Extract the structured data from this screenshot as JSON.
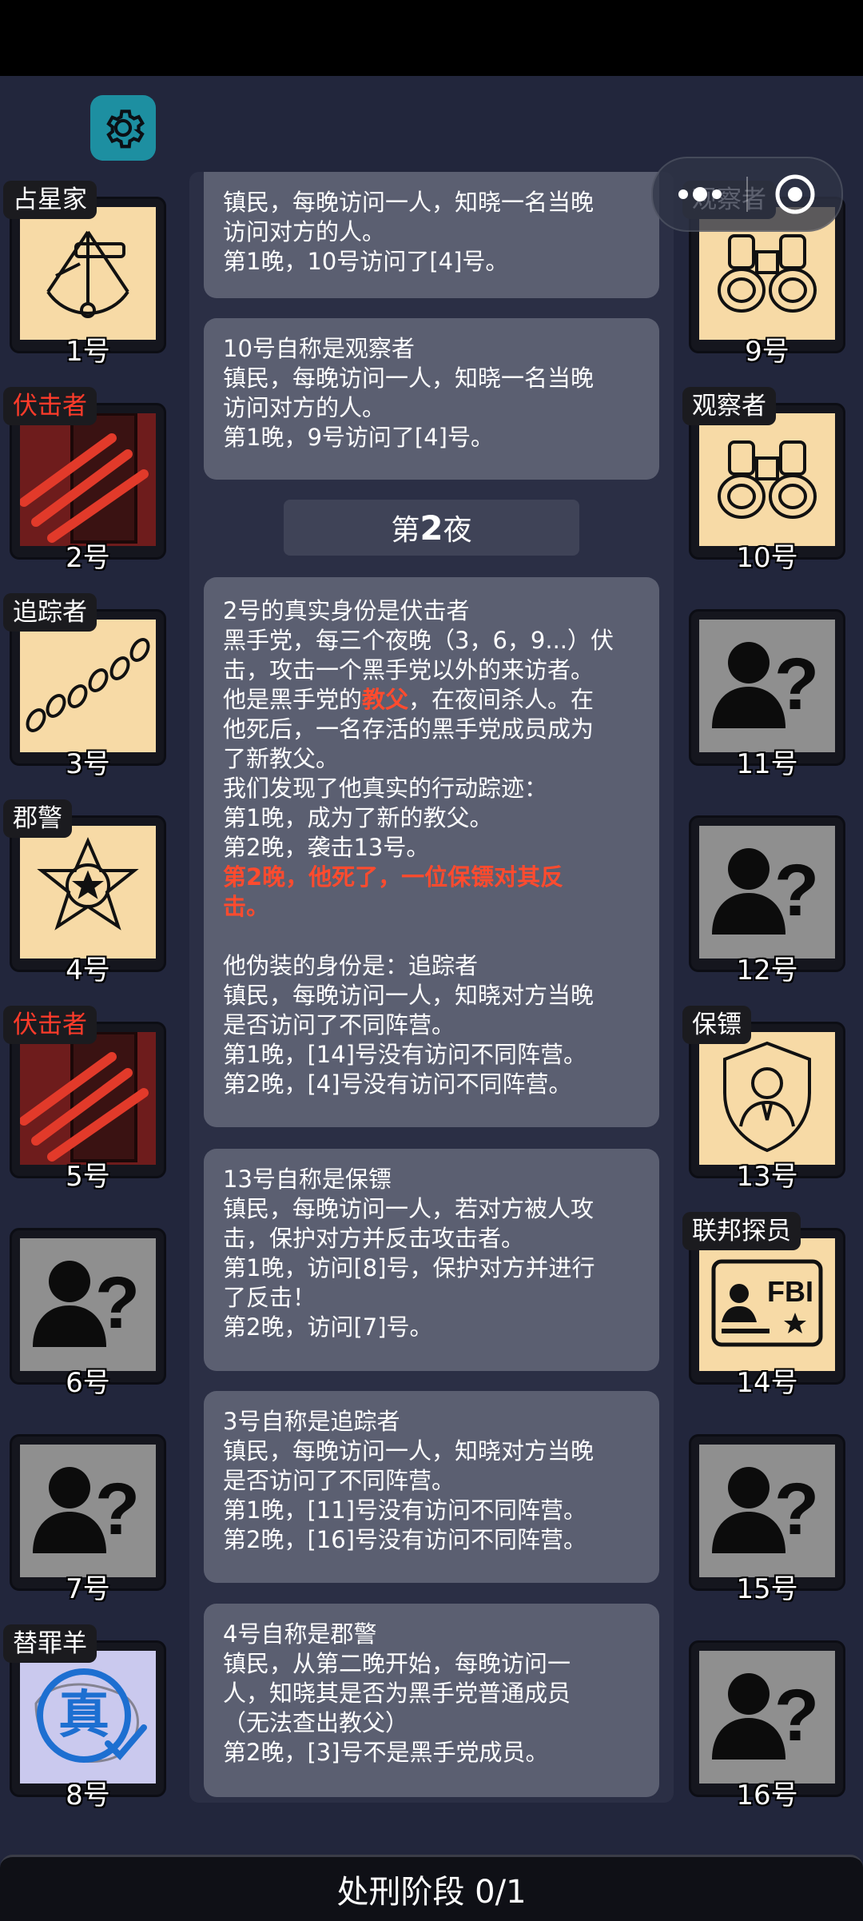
{
  "header": {
    "settings_icon": "gear-icon",
    "capsule": {
      "more_icon": "more-dots-icon",
      "close_icon": "target-circle-icon"
    }
  },
  "left_players": [
    {
      "num": "1号",
      "tag": "占星家",
      "tag_red": false,
      "icon": "sextant-icon"
    },
    {
      "num": "2号",
      "tag": "伏击者",
      "tag_red": true,
      "icon": "claw-scratch-icon"
    },
    {
      "num": "3号",
      "tag": "追踪者",
      "tag_red": false,
      "icon": "footprints-icon"
    },
    {
      "num": "4号",
      "tag": "郡警",
      "tag_red": false,
      "icon": "sheriff-badge-icon"
    },
    {
      "num": "5号",
      "tag": "伏击者",
      "tag_red": true,
      "icon": "claw-scratch-icon"
    },
    {
      "num": "6号",
      "tag": "",
      "tag_red": false,
      "icon": "unknown-person-icon"
    },
    {
      "num": "7号",
      "tag": "",
      "tag_red": false,
      "icon": "unknown-person-icon"
    },
    {
      "num": "8号",
      "tag": "替罪羊",
      "tag_red": false,
      "icon": "true-stamp-icon",
      "stamp_text": "真"
    }
  ],
  "right_players": [
    {
      "num": "9号",
      "tag": "观察者",
      "tag_red": false,
      "icon": "binoculars-icon"
    },
    {
      "num": "10号",
      "tag": "观察者",
      "tag_red": false,
      "icon": "binoculars-icon"
    },
    {
      "num": "11号",
      "tag": "",
      "tag_red": false,
      "icon": "unknown-person-icon"
    },
    {
      "num": "12号",
      "tag": "",
      "tag_red": false,
      "icon": "unknown-person-icon"
    },
    {
      "num": "13号",
      "tag": "保镖",
      "tag_red": false,
      "icon": "bodyguard-shield-icon"
    },
    {
      "num": "14号",
      "tag": "联邦探员",
      "tag_red": false,
      "icon": "fbi-card-icon",
      "fbi_text": "FBI"
    },
    {
      "num": "15号",
      "tag": "",
      "tag_red": false,
      "icon": "unknown-person-icon"
    },
    {
      "num": "16号",
      "tag": "",
      "tag_red": false,
      "icon": "unknown-person-icon"
    }
  ],
  "night_label": {
    "pre": "第",
    "num": "2",
    "post": "夜"
  },
  "log": [
    {
      "lines": [
        {
          "t": "镇民，每晚访问一人，知晓一名当晚"
        },
        {
          "t": "访问对方的人。"
        },
        {
          "t": "第1晚，10号访问了[4]号。"
        }
      ]
    },
    {
      "lines": [
        {
          "t": "10号自称是观察者"
        },
        {
          "t": "镇民，每晚访问一人，知晓一名当晚"
        },
        {
          "t": "访问对方的人。"
        },
        {
          "t": "第1晚，9号访问了[4]号。"
        }
      ]
    },
    {
      "lines": [
        {
          "t": "2号的真实身份是伏击者"
        },
        {
          "t": "黑手党，每三个夜晚（3，6，9...）伏"
        },
        {
          "t": "击，攻击一个黑手党以外的来访者。"
        },
        {
          "t": "他是黑手党的",
          "red": "教父",
          "after": "，在夜间杀人。在"
        },
        {
          "t": "他死后，一名存活的黑手党成员成为"
        },
        {
          "t": "了新教父。"
        },
        {
          "t": "我们发现了他真实的行动踪迹："
        },
        {
          "t": "第1晚，成为了新的教父。"
        },
        {
          "t": "第2晚，袭击13号。"
        },
        {
          "red_line": "第2晚，他死了，一位保镖对其反"
        },
        {
          "red_line": "击。"
        },
        {
          "t": " "
        },
        {
          "t": "他伪装的身份是：追踪者"
        },
        {
          "t": "镇民，每晚访问一人，知晓对方当晚"
        },
        {
          "t": "是否访问了不同阵营。"
        },
        {
          "t": "第1晚，[14]号没有访问不同阵营。"
        },
        {
          "t": "第2晚，[4]号没有访问不同阵营。"
        }
      ]
    },
    {
      "lines": [
        {
          "t": "13号自称是保镖"
        },
        {
          "t": "镇民，每晚访问一人，若对方被人攻"
        },
        {
          "t": "击，保护对方并反击攻击者。"
        },
        {
          "t": "第1晚，访问[8]号，保护对方并进行"
        },
        {
          "t": "了反击！"
        },
        {
          "t": "第2晚，访问[7]号。"
        }
      ]
    },
    {
      "lines": [
        {
          "t": "3号自称是追踪者"
        },
        {
          "t": "镇民，每晚访问一人，知晓对方当晚"
        },
        {
          "t": "是否访问了不同阵营。"
        },
        {
          "t": "第1晚，[11]号没有访问不同阵营。"
        },
        {
          "t": "第2晚，[16]号没有访问不同阵营。"
        }
      ]
    },
    {
      "lines": [
        {
          "t": "4号自称是郡警"
        },
        {
          "t": "镇民，从第二晚开始，每晚访问一"
        },
        {
          "t": "人，知晓其是否为黑手党普通成员"
        },
        {
          "t": "（无法查出教父）"
        },
        {
          "t": "第2晚，[3]号不是黑手党成员。"
        }
      ]
    }
  ],
  "bottom_bar": {
    "label": "处刑阶段 0/1"
  },
  "colors": {
    "background": "#22263c",
    "card_role": "#f7daa6",
    "card_unknown": "#8f8f8f",
    "mafia_red": "#ff3b2a",
    "settings": "#1d8fa1"
  }
}
